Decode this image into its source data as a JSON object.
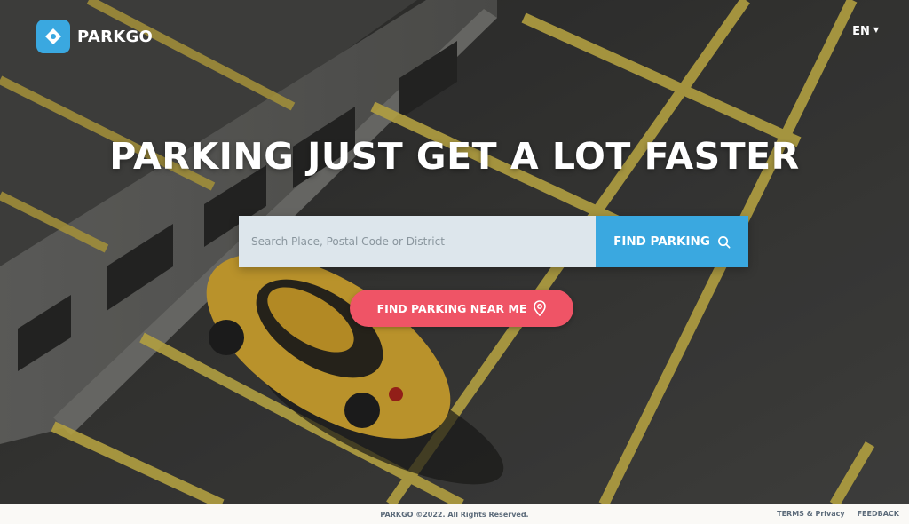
{
  "brand": {
    "name": "PARKGO",
    "logo_icon": "parking-pin-icon",
    "accent": "#3aa8e0"
  },
  "header": {
    "language": "EN"
  },
  "hero": {
    "headline": "PARKING JUST GET A LOT FASTER",
    "search": {
      "placeholder": "Search Place, Postal Code or District",
      "value": "",
      "button_label": "FIND PARKING",
      "button_icon": "search-icon"
    },
    "near_me": {
      "label": "FIND PARKING NEAR ME",
      "icon": "location-pin-icon",
      "color": "#ef5466"
    }
  },
  "footer": {
    "copyright": "PARKGO ©2022. All Rights Reserved.",
    "links": [
      "TERMS & Privacy",
      "FEEDBACK"
    ]
  }
}
